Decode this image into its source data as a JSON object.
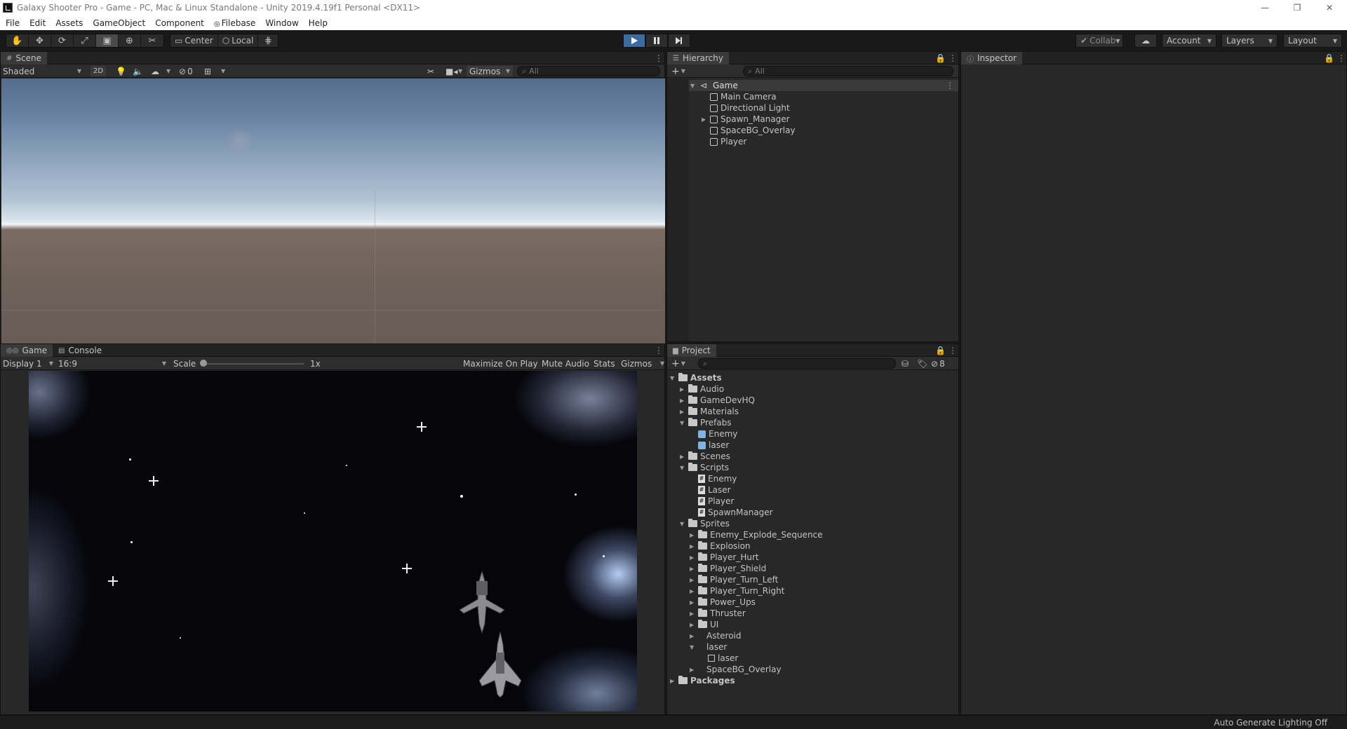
{
  "window": {
    "title": "Galaxy Shooter Pro - Game - PC, Mac & Linux Standalone - Unity 2019.4.19f1 Personal <DX11>",
    "controls": [
      "—",
      "❐",
      "✕"
    ]
  },
  "menu": [
    "File",
    "Edit",
    "Assets",
    "GameObject",
    "Component",
    "Filebase",
    "Window",
    "Help"
  ],
  "toolbar": {
    "pivot": "Center",
    "space": "Local",
    "collab": "Collab",
    "account": "Account",
    "layers": "Layers",
    "layout": "Layout"
  },
  "scene": {
    "tab": "Scene",
    "shading": "Shaded",
    "mode_2d": "2D",
    "hidden_count": "0",
    "gizmos": "Gizmos",
    "search_placeholder": "All"
  },
  "game": {
    "tabs": [
      "Game",
      "Console"
    ],
    "display": "Display 1",
    "aspect": "16:9",
    "scale_label": "Scale",
    "scale_value": "1x",
    "buttons": [
      "Maximize On Play",
      "Mute Audio",
      "Stats",
      "Gizmos"
    ]
  },
  "hierarchy": {
    "tab": "Hierarchy",
    "search_placeholder": "All",
    "scene": "Game",
    "items": [
      "Main Camera",
      "Directional Light",
      "Spawn_Manager",
      "SpaceBG_Overlay",
      "Player"
    ]
  },
  "inspector": {
    "tab": "Inspector"
  },
  "project": {
    "tab": "Project",
    "hidden_count": "8",
    "tree": [
      {
        "label": "Assets",
        "type": "folder",
        "depth": 0,
        "expanded": true,
        "bold": true
      },
      {
        "label": "Audio",
        "type": "folder",
        "depth": 1
      },
      {
        "label": "GameDevHQ",
        "type": "folder",
        "depth": 1
      },
      {
        "label": "Materials",
        "type": "folder",
        "depth": 1
      },
      {
        "label": "Prefabs",
        "type": "folder",
        "depth": 1,
        "expanded": true
      },
      {
        "label": "Enemy",
        "type": "prefab",
        "depth": 2
      },
      {
        "label": "laser",
        "type": "prefab",
        "depth": 2
      },
      {
        "label": "Scenes",
        "type": "folder",
        "depth": 1
      },
      {
        "label": "Scripts",
        "type": "folder",
        "depth": 1,
        "expanded": true
      },
      {
        "label": "Enemy",
        "type": "script",
        "depth": 2
      },
      {
        "label": "Laser",
        "type": "script",
        "depth": 2
      },
      {
        "label": "Player",
        "type": "script",
        "depth": 2
      },
      {
        "label": "SpawnManager",
        "type": "script",
        "depth": 2
      },
      {
        "label": "Sprites",
        "type": "folder",
        "depth": 1,
        "expanded": true
      },
      {
        "label": "Enemy_Explode_Sequence",
        "type": "folder",
        "depth": 2
      },
      {
        "label": "Explosion",
        "type": "folder",
        "depth": 2
      },
      {
        "label": "Player_Hurt",
        "type": "folder",
        "depth": 2
      },
      {
        "label": "Player_Shield",
        "type": "folder",
        "depth": 2
      },
      {
        "label": "Player_Turn_Left",
        "type": "folder",
        "depth": 2
      },
      {
        "label": "Player_Turn_Right",
        "type": "folder",
        "depth": 2
      },
      {
        "label": "Power_Ups",
        "type": "folder",
        "depth": 2
      },
      {
        "label": "Thruster",
        "type": "folder",
        "depth": 2
      },
      {
        "label": "UI",
        "type": "folder",
        "depth": 2
      },
      {
        "label": "Asteroid",
        "type": "sprite",
        "depth": 2
      },
      {
        "label": "laser",
        "type": "sprite",
        "depth": 2,
        "expanded": true
      },
      {
        "label": "laser",
        "type": "sprite-sub",
        "depth": 3
      },
      {
        "label": "SpaceBG_Overlay",
        "type": "sprite",
        "depth": 2
      },
      {
        "label": "Packages",
        "type": "folder",
        "depth": 0,
        "bold": true
      }
    ]
  },
  "status": {
    "text": "Auto Generate Lighting Off"
  }
}
